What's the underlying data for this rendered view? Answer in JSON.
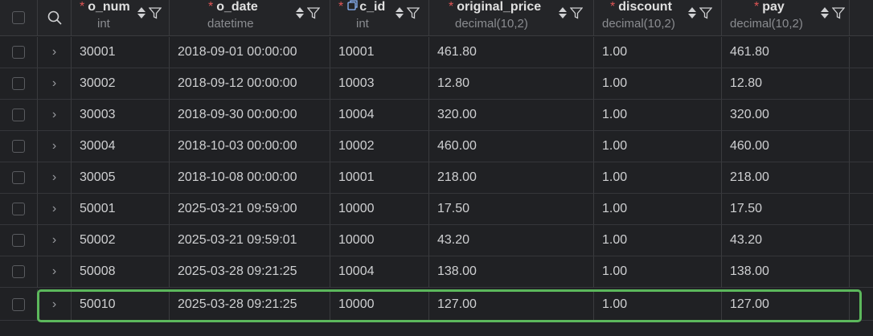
{
  "header": {
    "columns": [
      {
        "name": "o_num",
        "type": "int"
      },
      {
        "name": "o_date",
        "type": "datetime"
      },
      {
        "name": "c_id",
        "type": "int"
      },
      {
        "name": "original_price",
        "type": "decimal(10,2)"
      },
      {
        "name": "discount",
        "type": "decimal(10,2)"
      },
      {
        "name": "pay",
        "type": "decimal(10,2)"
      }
    ]
  },
  "rows": [
    [
      "30001",
      "2018-09-01 00:00:00",
      "10001",
      "461.80",
      "1.00",
      "461.80"
    ],
    [
      "30002",
      "2018-09-12 00:00:00",
      "10003",
      "12.80",
      "1.00",
      "12.80"
    ],
    [
      "30003",
      "2018-09-30 00:00:00",
      "10004",
      "320.00",
      "1.00",
      "320.00"
    ],
    [
      "30004",
      "2018-10-03 00:00:00",
      "10002",
      "460.00",
      "1.00",
      "460.00"
    ],
    [
      "30005",
      "2018-10-08 00:00:00",
      "10001",
      "218.00",
      "1.00",
      "218.00"
    ],
    [
      "50001",
      "2025-03-21 09:59:00",
      "10000",
      "17.50",
      "1.00",
      "17.50"
    ],
    [
      "50002",
      "2025-03-21 09:59:01",
      "10000",
      "43.20",
      "1.00",
      "43.20"
    ],
    [
      "50008",
      "2025-03-28 09:21:25",
      "10004",
      "138.00",
      "1.00",
      "138.00"
    ],
    [
      "50010",
      "2025-03-28 09:21:25",
      "10000",
      "127.00",
      "1.00",
      "127.00"
    ]
  ],
  "selected_row": 8,
  "colors": {
    "background": "#202124",
    "selection_outline": "#5cb85c",
    "required_marker": "#e05555"
  }
}
